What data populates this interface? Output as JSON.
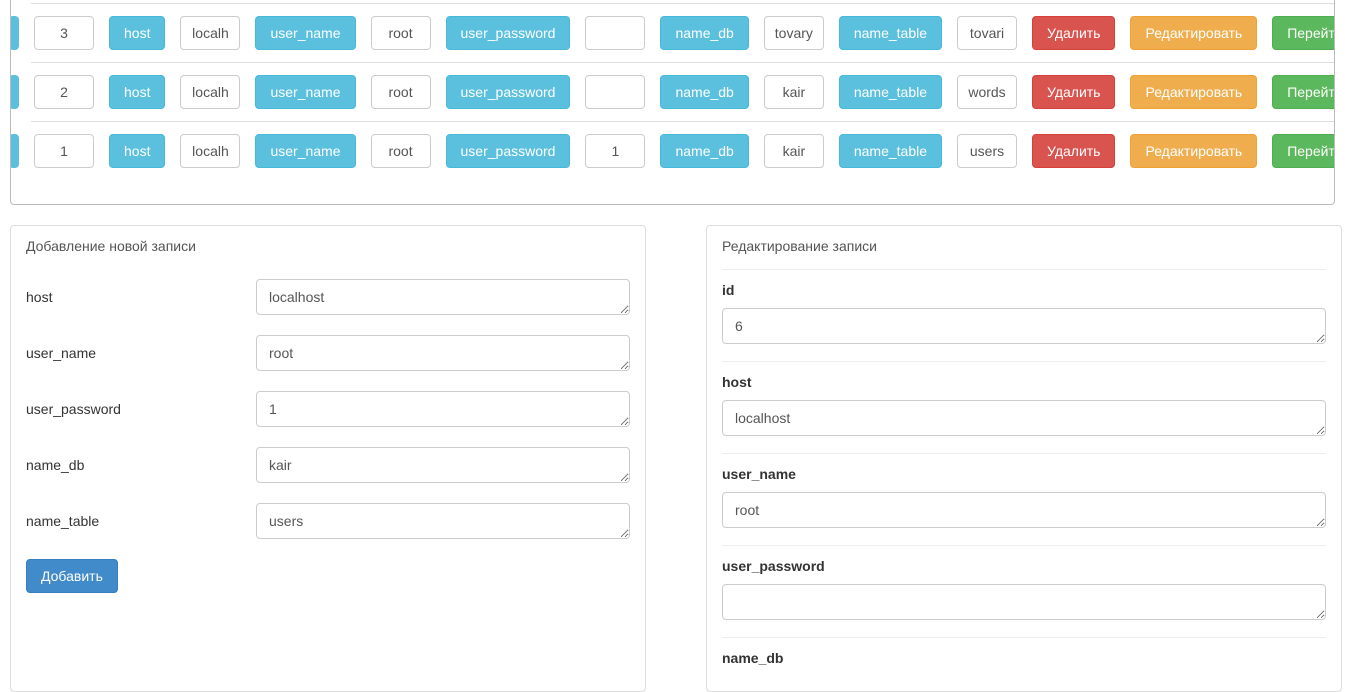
{
  "labels": {
    "host": "host",
    "user_name": "user_name",
    "user_password": "user_password",
    "name_db": "name_db",
    "name_table": "name_table",
    "delete": "Удалить",
    "edit": "Редактировать",
    "go": "Перейти",
    "add": "Добавить"
  },
  "rows": [
    {
      "id": "3",
      "host": "localh",
      "user_name": "root",
      "user_password": "",
      "name_db": "tovary",
      "name_table": "tovari"
    },
    {
      "id": "2",
      "host": "localh",
      "user_name": "root",
      "user_password": "",
      "name_db": "kair",
      "name_table": "words"
    },
    {
      "id": "1",
      "host": "localh",
      "user_name": "root",
      "user_password": "1",
      "name_db": "kair",
      "name_table": "users"
    }
  ],
  "add_form": {
    "title": "Добавление новой записи",
    "host": "localhost",
    "user_name": "root",
    "user_password": "1",
    "name_db": "kair",
    "name_table": "users"
  },
  "edit_form": {
    "title": "Редактирование записи",
    "fields": {
      "id_label": "id",
      "id_value": "6",
      "host_label": "host",
      "host_value": "localhost",
      "user_name_label": "user_name",
      "user_name_value": "root",
      "user_password_label": "user_password",
      "user_password_value": "",
      "name_db_label": "name_db"
    }
  }
}
